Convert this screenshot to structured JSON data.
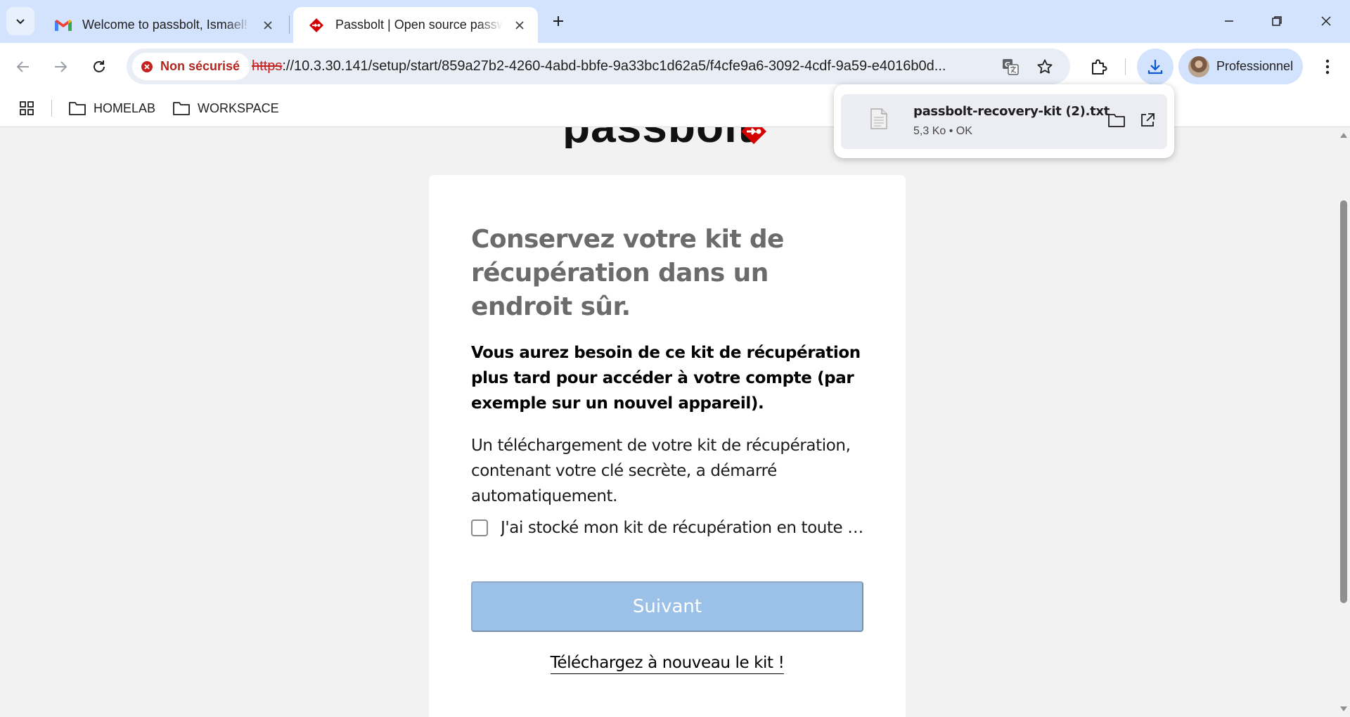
{
  "browser": {
    "tabs": [
      {
        "title": "Welcome to passbolt, Ismael! - ",
        "favicon": "gmail-icon",
        "active": false
      },
      {
        "title": "Passbolt | Open source password manager",
        "favicon": "passbolt-icon",
        "active": true
      }
    ],
    "security_label": "Non sécurisé",
    "url_scheme": "https",
    "url_rest": "://10.3.30.141/setup/start/859a27b2-4260-4abd-bbfe-9a33bc1d62a5/f4cfe9a6-3092-4cdf-9a59-e4016b0d...",
    "profile_label": "Professionnel",
    "bookmarks": [
      "HOMELAB",
      "WORKSPACE"
    ]
  },
  "download": {
    "filename": "passbolt-recovery-kit (2).txt",
    "meta": "5,3 Ko • OK"
  },
  "page": {
    "heading": "Conservez votre kit de récupération dans un endroit sûr.",
    "lead": "Vous aurez besoin de ce kit de récupération plus tard pour accéder à votre compte (par exemple sur un nouvel appareil).",
    "paragraph": "Un téléchargement de votre kit de récupération, contenant votre clé secrète, a démarré automatiquement.",
    "checkbox_label": "J'ai stocké mon kit de récupération en toute sécurité.",
    "checkbox_checked": false,
    "next_button": "Suivant",
    "redownload_link": "Téléchargez à nouveau le kit !"
  },
  "colors": {
    "tabstrip": "#d3e3fd",
    "insecure": "#c5221f",
    "next_button_disabled": "#9cc1e9",
    "heading": "#6b6b6b",
    "passbolt_red": "#d40101"
  }
}
